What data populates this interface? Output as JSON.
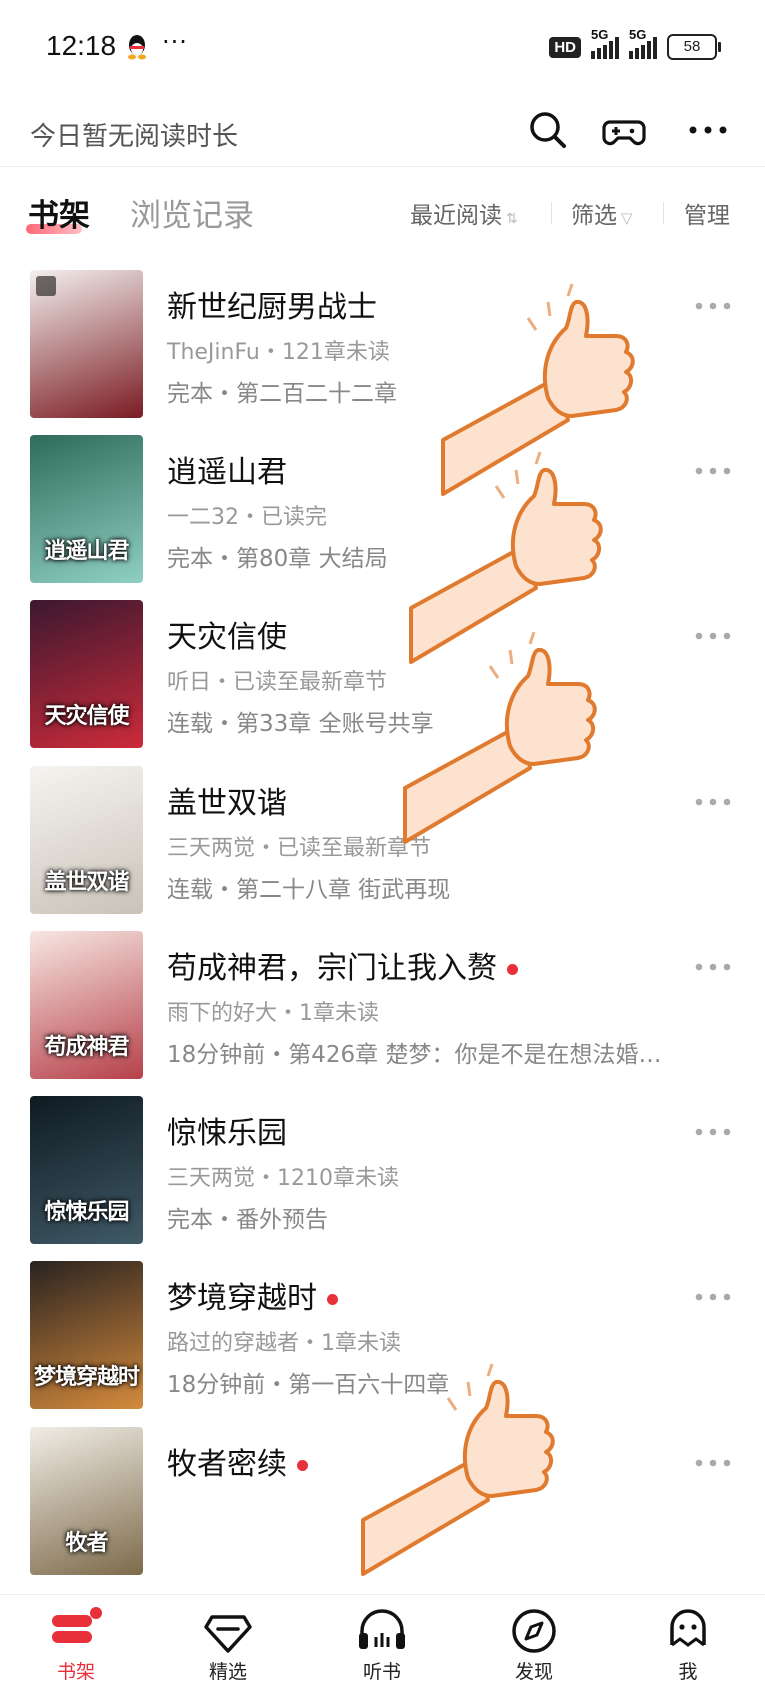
{
  "status_bar": {
    "time": "12:18",
    "more": "···",
    "hd_label": "HD",
    "signal1_label": "5G",
    "signal2_label": "5G",
    "battery": "58"
  },
  "header": {
    "reading_time": "今日暂无阅读时长",
    "icons": [
      "search-icon",
      "gamepad-icon",
      "more-icon"
    ]
  },
  "tabs": {
    "shelf": "书架",
    "history": "浏览记录",
    "sort": "最近阅读",
    "sort_icon": "⇅",
    "filter": "筛选",
    "filter_icon": "▽",
    "manage": "管理"
  },
  "books": [
    {
      "title": "新世纪厨男战士",
      "sub": "TheJinFu・121章未读",
      "detail": "完本・第二百二十二章",
      "cover_text": "",
      "new": false,
      "cover_colors": [
        "#f3f0ee",
        "#7a1b22"
      ]
    },
    {
      "title": "逍遥山君",
      "sub": "一二32・已读完",
      "detail": "完本・第80章 大结局",
      "cover_text": "逍遥山君",
      "new": false,
      "cover_colors": [
        "#2f6b5a",
        "#8fd0c2"
      ]
    },
    {
      "title": "天灾信使",
      "sub": "听日・已读至最新章节",
      "detail": "连载・第33章 全账号共享",
      "cover_text": "天灾信使",
      "new": false,
      "cover_colors": [
        "#3c1830",
        "#cc2b3a"
      ]
    },
    {
      "title": "盖世双谐",
      "sub": "三天两觉・已读至最新章节",
      "detail": "连载・第二十八章 街武再现",
      "cover_text": "盖世双谐",
      "new": false,
      "cover_colors": [
        "#f6f4f0",
        "#c9c2b8"
      ]
    },
    {
      "title": "苟成神君，宗门让我入赘",
      "sub": "雨下的好大・1章未读",
      "detail": "18分钟前・第426章 楚梦：你是不是在想法婚…",
      "cover_text": "苟成神君",
      "new": true,
      "cover_colors": [
        "#f7e7e2",
        "#b6404a"
      ]
    },
    {
      "title": "惊悚乐园",
      "sub": "三天两觉・1210章未读",
      "detail": "完本・番外预告",
      "cover_text": "惊悚乐园",
      "new": false,
      "cover_colors": [
        "#0f1a22",
        "#3f5a66"
      ]
    },
    {
      "title": "梦境穿越时",
      "sub": "路过的穿越者・1章未读",
      "detail": "18分钟前・第一百六十四章",
      "cover_text": "梦境穿越时",
      "new": true,
      "cover_colors": [
        "#2a2320",
        "#d48a3c"
      ]
    },
    {
      "title": "牧者密续",
      "sub": "",
      "detail": "",
      "cover_text": "牧者",
      "new": true,
      "cover_colors": [
        "#f1ede6",
        "#7d6a4a"
      ]
    }
  ],
  "bottom_nav": [
    {
      "label": "书架",
      "icon": "bookshelf-icon",
      "active": true
    },
    {
      "label": "精选",
      "icon": "gem-icon",
      "active": false
    },
    {
      "label": "听书",
      "icon": "headphones-icon",
      "active": false
    },
    {
      "label": "发现",
      "icon": "compass-icon",
      "active": false
    },
    {
      "label": "我",
      "icon": "profile-icon",
      "active": false
    }
  ],
  "colors": {
    "accent": "#e8303a",
    "thumb_skin": "#fde3cf",
    "thumb_outline": "#e07a2e"
  }
}
